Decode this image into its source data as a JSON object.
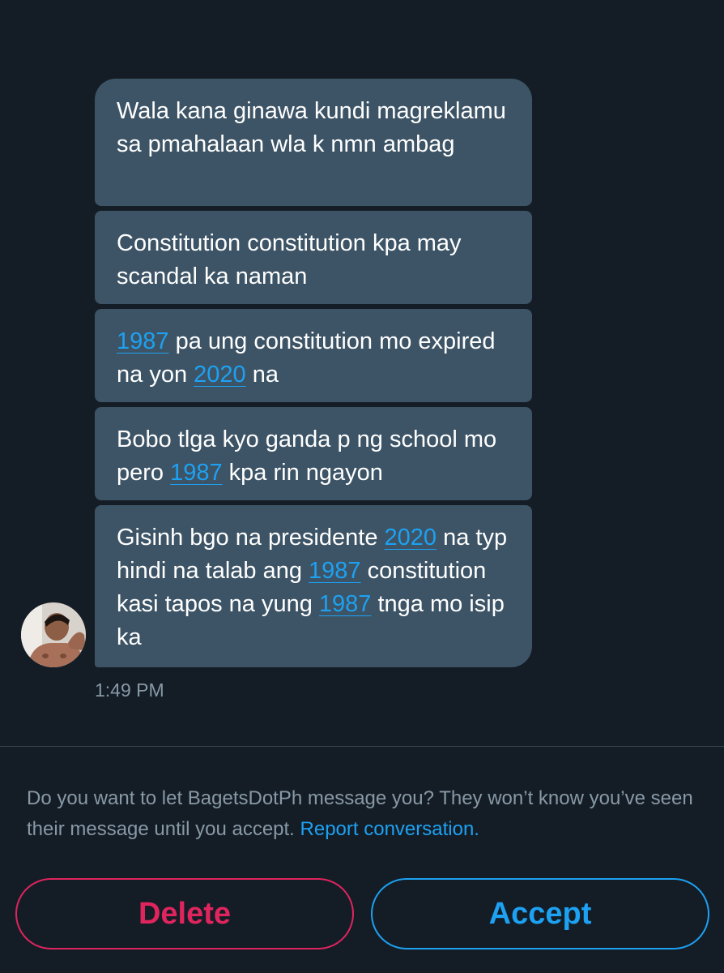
{
  "thread": {
    "messages": [
      {
        "segments": [
          {
            "text": "Wala kana ginawa kundi magreklamu sa pmahalaan wla k nmn ambag"
          }
        ]
      },
      {
        "segments": [
          {
            "text": "Constitution constitution kpa may scandal ka naman"
          }
        ]
      },
      {
        "segments": [
          {
            "text": "1987",
            "link": true
          },
          {
            "text": " pa ung constitution mo expired na yon "
          },
          {
            "text": "2020",
            "link": true
          },
          {
            "text": " na"
          }
        ]
      },
      {
        "segments": [
          {
            "text": "Bobo tlga kyo ganda p ng school mo pero "
          },
          {
            "text": "1987",
            "link": true
          },
          {
            "text": " kpa rin ngayon"
          }
        ]
      },
      {
        "segments": [
          {
            "text": "Gisinh bgo na presidente "
          },
          {
            "text": "2020",
            "link": true
          },
          {
            "text": " na typ hindi na talab ang "
          },
          {
            "text": "1987",
            "link": true
          },
          {
            "text": " constitution kasi tapos na yung "
          },
          {
            "text": "1987",
            "link": true
          },
          {
            "text": " tnga mo isip ka"
          }
        ]
      }
    ],
    "timestamp": "1:49 PM"
  },
  "request": {
    "prompt": "Do you want to let BagetsDotPh message you? They won’t know you’ve seen their message until you accept.",
    "report_link": "Report conversation.",
    "delete_label": "Delete",
    "accept_label": "Accept"
  },
  "colors": {
    "background": "#141d26",
    "bubble": "#3d5466",
    "link": "#1da1f2",
    "muted_text": "#8899a6",
    "delete": "#e0245e",
    "accept": "#1da1f2"
  }
}
